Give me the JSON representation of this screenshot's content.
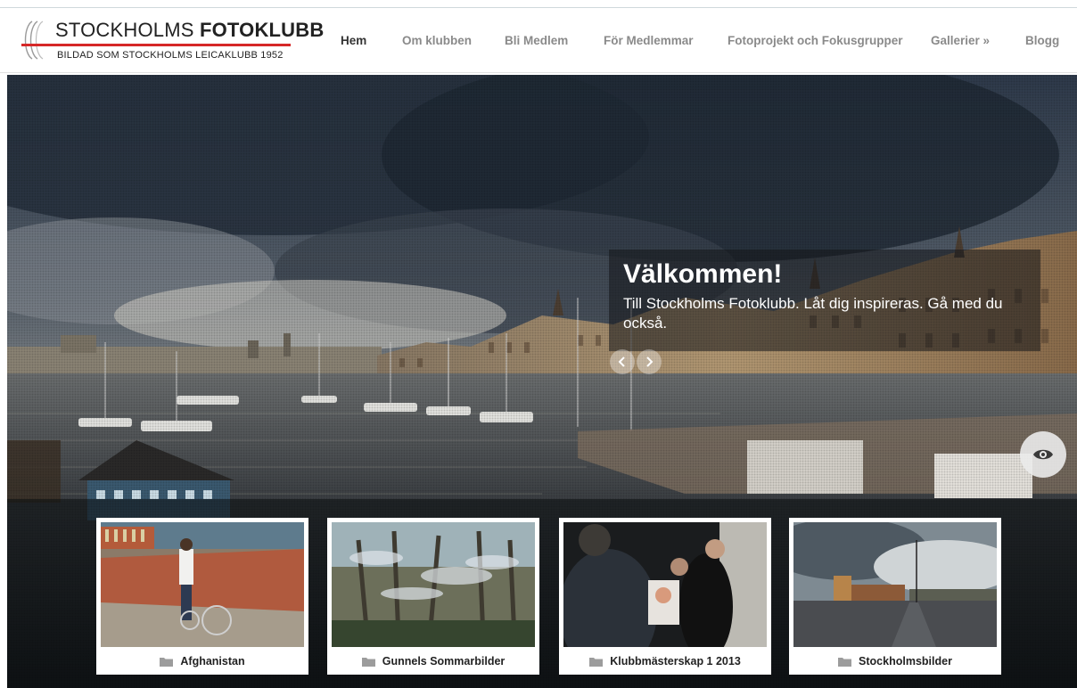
{
  "brand": {
    "title_regular": "STOCKHOLMS ",
    "title_bold": "FOTOKLUBB",
    "subtitle": "BILDAD SOM STOCKHOLMS LEICAKLUBB 1952",
    "accent": "#d62828"
  },
  "nav": {
    "items": [
      {
        "label": "Hem",
        "active": true
      },
      {
        "label": "Om klubben"
      },
      {
        "label": "Bli Medlem"
      },
      {
        "label": "För Medlemmar"
      },
      {
        "label": "Fotoprojekt och Fokusgrupper"
      },
      {
        "label": "Gallerier »"
      },
      {
        "label": "Blogg"
      }
    ]
  },
  "slider": {
    "caption_title": "Välkommen!",
    "caption_text": "Till Stockholms Fotoklubb. Låt dig inspireras. Gå med du också.",
    "prev_icon": "chevron-left-icon",
    "next_icon": "chevron-right-icon",
    "view_icon": "eye-icon"
  },
  "galleries": [
    {
      "label": "Afghanistan",
      "icon": "folder-icon"
    },
    {
      "label": "Gunnels Sommarbilder",
      "icon": "folder-icon"
    },
    {
      "label": "Klubbmästerskap 1 2013",
      "icon": "folder-icon"
    },
    {
      "label": "Stockholmsbilder",
      "icon": "folder-icon"
    }
  ]
}
